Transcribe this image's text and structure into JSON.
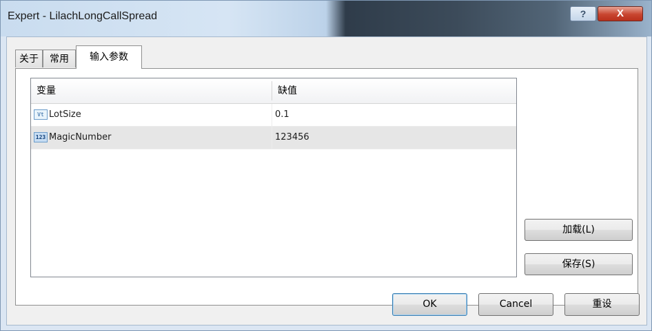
{
  "window": {
    "title": "Expert - LilachLongCallSpread"
  },
  "titlebar": {
    "help_label": "?",
    "close_label": "X"
  },
  "tabs": [
    {
      "label": "关于",
      "active": false
    },
    {
      "label": "常用",
      "active": false
    },
    {
      "label": "输入参数",
      "active": true
    }
  ],
  "table": {
    "columns": [
      "变量",
      "缺值"
    ],
    "rows": [
      {
        "icon": "vt-type-icon",
        "icon_text": "Vt",
        "name": "LotSize",
        "value": "0.1",
        "selected": false
      },
      {
        "icon": "integer-type-icon",
        "icon_text": "123",
        "name": "MagicNumber",
        "value": "123456",
        "selected": true
      }
    ]
  },
  "side_buttons": {
    "load_label": "加载(L)",
    "save_label": "保存(S)"
  },
  "footer_buttons": {
    "ok_label": "OK",
    "cancel_label": "Cancel",
    "reset_label": "重设"
  }
}
